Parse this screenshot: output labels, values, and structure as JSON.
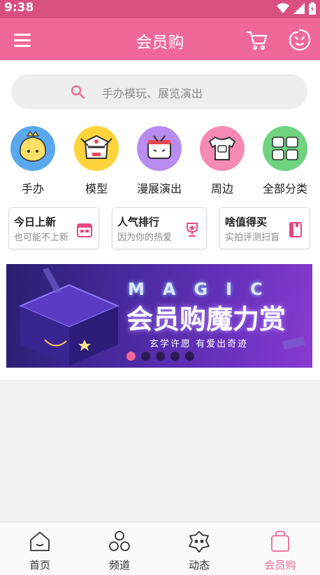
{
  "status_bar": {
    "time": "9:38"
  },
  "app_bar": {
    "title": "会员购",
    "menu_icon": "menu-icon",
    "cart_icon": "cart-icon",
    "service_icon": "customer-service-icon"
  },
  "search": {
    "placeholder": "手办模玩、展览演出"
  },
  "categories": [
    {
      "label": "手办",
      "color": "#5aa8f0"
    },
    {
      "label": "模型",
      "color": "#ffd43b"
    },
    {
      "label": "漫展演出",
      "color": "#b98cf0"
    },
    {
      "label": "周边",
      "color": "#f58ab4"
    },
    {
      "label": "全部分类",
      "color": "#6fd37f"
    }
  ],
  "cards": [
    {
      "title": "今日上新",
      "subtitle": "也可能不上新",
      "icon": "calendar-icon"
    },
    {
      "title": "人气排行",
      "subtitle": "因为你的热爱",
      "icon": "trophy-icon"
    },
    {
      "title": "啥值得买",
      "subtitle": "实拍评测扫盲",
      "icon": "book-icon"
    }
  ],
  "banner": {
    "headline_en": "MAGIC",
    "headline": "会员购魔力赏",
    "tagline": "玄学许愿 有爱出奇迹",
    "slide_count": 5,
    "active_slide": 1
  },
  "tabs": [
    {
      "label": "首页",
      "icon": "home-icon"
    },
    {
      "label": "频道",
      "icon": "channel-icon"
    },
    {
      "label": "动态",
      "icon": "dynamic-icon"
    },
    {
      "label": "会员购",
      "icon": "shopping-bag-icon",
      "active": true
    }
  ],
  "colors": {
    "accent": "#f0689a",
    "status_bar": "#d94f80"
  }
}
